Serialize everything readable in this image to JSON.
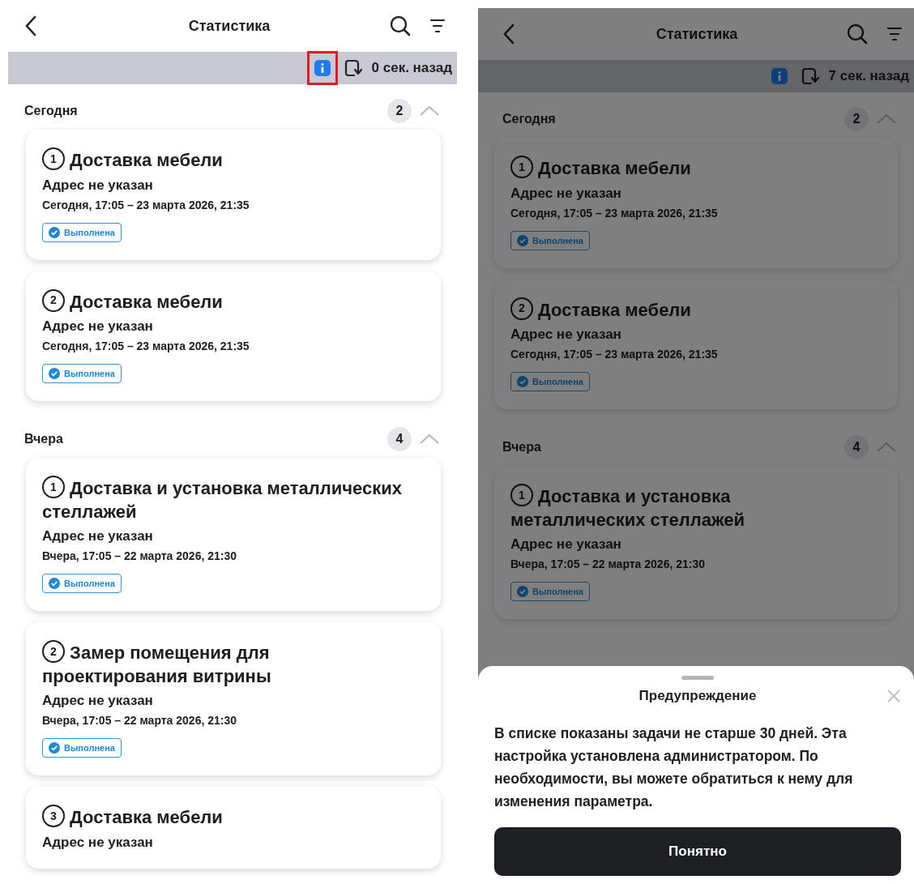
{
  "screens": [
    {
      "title": "Статистика",
      "updated": "0 сек. назад",
      "info_highlighted": true,
      "dimmed": false,
      "groups": [
        {
          "label": "Сегодня",
          "count": "2",
          "expanded": true,
          "cards": [
            {
              "number": "1",
              "title": "Доставка мебели",
              "address": "Адрес не указан",
              "time": "Сегодня, 17:05 – 23 марта 2026, 21:35",
              "status": "Выполнена"
            },
            {
              "number": "2",
              "title": "Доставка мебели",
              "address": "Адрес не указан",
              "time": "Сегодня, 17:05 – 23 марта 2026, 21:35",
              "status": "Выполнена"
            }
          ]
        },
        {
          "label": "Вчера",
          "count": "4",
          "expanded": true,
          "cards": [
            {
              "number": "1",
              "title": "Доставка и установка металлических стеллажей",
              "address": "Адрес не указан",
              "time": "Вчера, 17:05 – 22 марта 2026, 21:30",
              "status": "Выполнена"
            },
            {
              "number": "2",
              "title": "Замер помещения для проектирования витрины",
              "address": "Адрес не указан",
              "time": "Вчера, 17:05 – 22 марта 2026, 21:30",
              "status": "Выполнена"
            },
            {
              "number": "3",
              "title": "Доставка мебели",
              "address": "Адрес не указан"
            }
          ]
        }
      ]
    },
    {
      "title": "Статистика",
      "updated": "7 сек. назад",
      "info_highlighted": false,
      "dimmed": true,
      "groups": [
        {
          "label": "Сегодня",
          "count": "2",
          "expanded": true,
          "cards": [
            {
              "number": "1",
              "title": "Доставка мебели",
              "address": "Адрес не указан",
              "time": "Сегодня, 17:05 – 23 марта 2026, 21:35",
              "status": "Выполнена"
            },
            {
              "number": "2",
              "title": "Доставка мебели",
              "address": "Адрес не указан",
              "time": "Сегодня, 17:05 – 23 марта 2026, 21:35",
              "status": "Выполнена"
            }
          ]
        },
        {
          "label": "Вчера",
          "count": "4",
          "expanded": true,
          "cards": [
            {
              "number": "1",
              "title": "Доставка и установка металлических стеллажей",
              "address": "Адрес не указан",
              "time": "Вчера, 17:05 – 22 марта 2026, 21:30",
              "status": "Выполнена"
            }
          ]
        }
      ],
      "sheet": {
        "title": "Предупреждение",
        "message": "В списке показаны задачи не старше 30 дней. Эта настройка установлена администратором. По необходимости, вы можете обратиться к нему для изменения параметра.",
        "button": "Понятно"
      }
    }
  ]
}
